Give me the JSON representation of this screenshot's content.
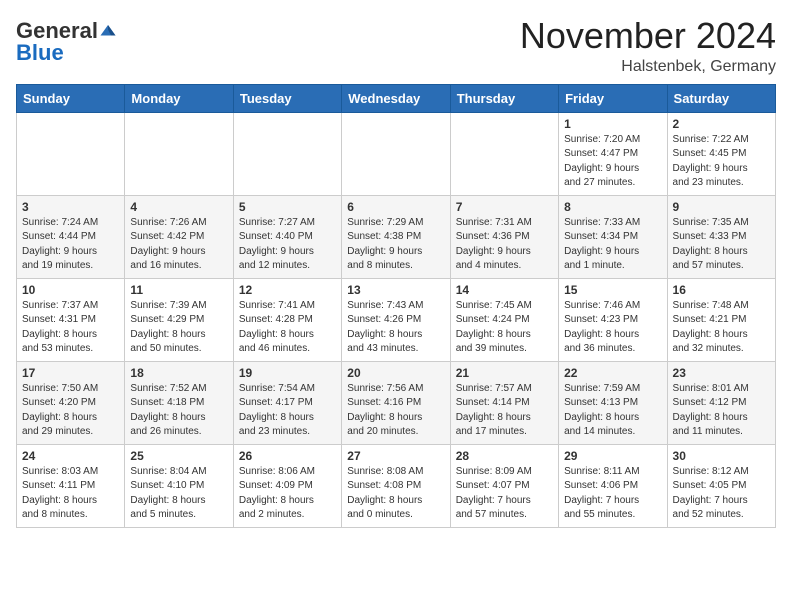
{
  "header": {
    "logo_general": "General",
    "logo_blue": "Blue",
    "month_title": "November 2024",
    "location": "Halstenbek, Germany"
  },
  "weekdays": [
    "Sunday",
    "Monday",
    "Tuesday",
    "Wednesday",
    "Thursday",
    "Friday",
    "Saturday"
  ],
  "weeks": [
    [
      {
        "day": "",
        "info": ""
      },
      {
        "day": "",
        "info": ""
      },
      {
        "day": "",
        "info": ""
      },
      {
        "day": "",
        "info": ""
      },
      {
        "day": "",
        "info": ""
      },
      {
        "day": "1",
        "info": "Sunrise: 7:20 AM\nSunset: 4:47 PM\nDaylight: 9 hours\nand 27 minutes."
      },
      {
        "day": "2",
        "info": "Sunrise: 7:22 AM\nSunset: 4:45 PM\nDaylight: 9 hours\nand 23 minutes."
      }
    ],
    [
      {
        "day": "3",
        "info": "Sunrise: 7:24 AM\nSunset: 4:44 PM\nDaylight: 9 hours\nand 19 minutes."
      },
      {
        "day": "4",
        "info": "Sunrise: 7:26 AM\nSunset: 4:42 PM\nDaylight: 9 hours\nand 16 minutes."
      },
      {
        "day": "5",
        "info": "Sunrise: 7:27 AM\nSunset: 4:40 PM\nDaylight: 9 hours\nand 12 minutes."
      },
      {
        "day": "6",
        "info": "Sunrise: 7:29 AM\nSunset: 4:38 PM\nDaylight: 9 hours\nand 8 minutes."
      },
      {
        "day": "7",
        "info": "Sunrise: 7:31 AM\nSunset: 4:36 PM\nDaylight: 9 hours\nand 4 minutes."
      },
      {
        "day": "8",
        "info": "Sunrise: 7:33 AM\nSunset: 4:34 PM\nDaylight: 9 hours\nand 1 minute."
      },
      {
        "day": "9",
        "info": "Sunrise: 7:35 AM\nSunset: 4:33 PM\nDaylight: 8 hours\nand 57 minutes."
      }
    ],
    [
      {
        "day": "10",
        "info": "Sunrise: 7:37 AM\nSunset: 4:31 PM\nDaylight: 8 hours\nand 53 minutes."
      },
      {
        "day": "11",
        "info": "Sunrise: 7:39 AM\nSunset: 4:29 PM\nDaylight: 8 hours\nand 50 minutes."
      },
      {
        "day": "12",
        "info": "Sunrise: 7:41 AM\nSunset: 4:28 PM\nDaylight: 8 hours\nand 46 minutes."
      },
      {
        "day": "13",
        "info": "Sunrise: 7:43 AM\nSunset: 4:26 PM\nDaylight: 8 hours\nand 43 minutes."
      },
      {
        "day": "14",
        "info": "Sunrise: 7:45 AM\nSunset: 4:24 PM\nDaylight: 8 hours\nand 39 minutes."
      },
      {
        "day": "15",
        "info": "Sunrise: 7:46 AM\nSunset: 4:23 PM\nDaylight: 8 hours\nand 36 minutes."
      },
      {
        "day": "16",
        "info": "Sunrise: 7:48 AM\nSunset: 4:21 PM\nDaylight: 8 hours\nand 32 minutes."
      }
    ],
    [
      {
        "day": "17",
        "info": "Sunrise: 7:50 AM\nSunset: 4:20 PM\nDaylight: 8 hours\nand 29 minutes."
      },
      {
        "day": "18",
        "info": "Sunrise: 7:52 AM\nSunset: 4:18 PM\nDaylight: 8 hours\nand 26 minutes."
      },
      {
        "day": "19",
        "info": "Sunrise: 7:54 AM\nSunset: 4:17 PM\nDaylight: 8 hours\nand 23 minutes."
      },
      {
        "day": "20",
        "info": "Sunrise: 7:56 AM\nSunset: 4:16 PM\nDaylight: 8 hours\nand 20 minutes."
      },
      {
        "day": "21",
        "info": "Sunrise: 7:57 AM\nSunset: 4:14 PM\nDaylight: 8 hours\nand 17 minutes."
      },
      {
        "day": "22",
        "info": "Sunrise: 7:59 AM\nSunset: 4:13 PM\nDaylight: 8 hours\nand 14 minutes."
      },
      {
        "day": "23",
        "info": "Sunrise: 8:01 AM\nSunset: 4:12 PM\nDaylight: 8 hours\nand 11 minutes."
      }
    ],
    [
      {
        "day": "24",
        "info": "Sunrise: 8:03 AM\nSunset: 4:11 PM\nDaylight: 8 hours\nand 8 minutes."
      },
      {
        "day": "25",
        "info": "Sunrise: 8:04 AM\nSunset: 4:10 PM\nDaylight: 8 hours\nand 5 minutes."
      },
      {
        "day": "26",
        "info": "Sunrise: 8:06 AM\nSunset: 4:09 PM\nDaylight: 8 hours\nand 2 minutes."
      },
      {
        "day": "27",
        "info": "Sunrise: 8:08 AM\nSunset: 4:08 PM\nDaylight: 8 hours\nand 0 minutes."
      },
      {
        "day": "28",
        "info": "Sunrise: 8:09 AM\nSunset: 4:07 PM\nDaylight: 7 hours\nand 57 minutes."
      },
      {
        "day": "29",
        "info": "Sunrise: 8:11 AM\nSunset: 4:06 PM\nDaylight: 7 hours\nand 55 minutes."
      },
      {
        "day": "30",
        "info": "Sunrise: 8:12 AM\nSunset: 4:05 PM\nDaylight: 7 hours\nand 52 minutes."
      }
    ]
  ]
}
